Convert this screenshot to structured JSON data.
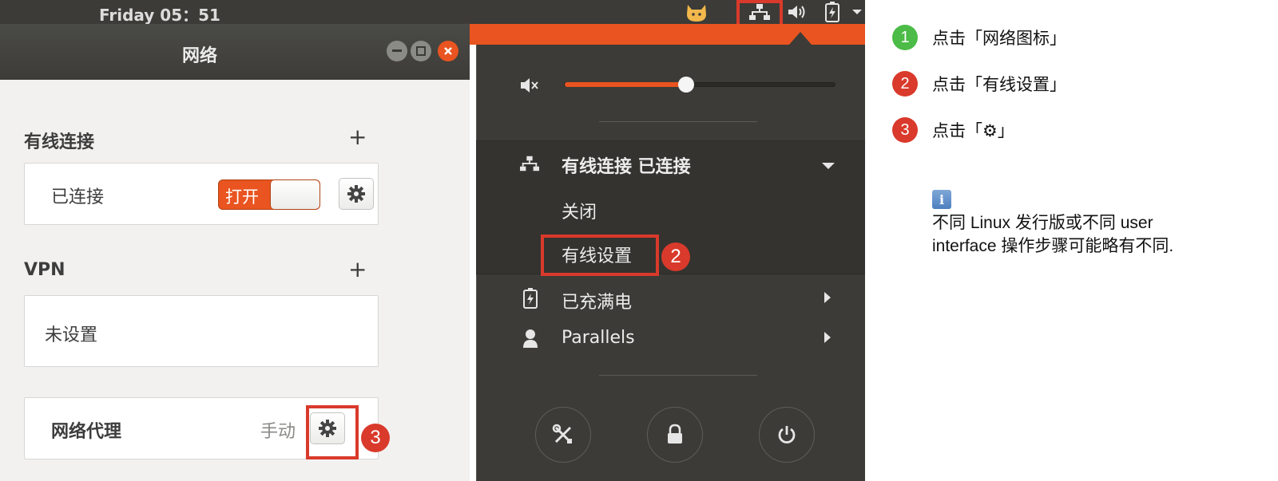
{
  "topbar": {
    "clock": "Friday 05：51",
    "icons": [
      "cat-icon",
      "network-icon",
      "volume-icon",
      "battery-icon",
      "chevron-down-icon"
    ]
  },
  "window": {
    "title": "网络",
    "wired": {
      "section_title": "有线连接",
      "status": "已连接",
      "toggle_label": "打开",
      "toggle_state": "on"
    },
    "vpn": {
      "section_title": "VPN",
      "status": "未设置"
    },
    "proxy": {
      "label": "网络代理",
      "mode": "手动"
    }
  },
  "popup": {
    "volume_level": 0.45,
    "wired_header": "有线连接 已连接",
    "turn_off": "关闭",
    "wired_settings": "有线设置",
    "battery": "已充满电",
    "user": "Parallels",
    "bottom_icons": [
      "tools-icon",
      "lock-icon",
      "power-icon"
    ]
  },
  "badges": {
    "one": "1",
    "two": "2",
    "three": "3"
  },
  "colors": {
    "accent": "#e95420",
    "step_green": "#4cbb47",
    "step_red": "#d93a2b",
    "panel_dark": "#3c3b37"
  },
  "instructions": {
    "steps": [
      {
        "num": "1",
        "text": "点击「网络图标」"
      },
      {
        "num": "2",
        "text": "点击「有线设置」"
      },
      {
        "num": "3",
        "text": "点击「⚙」"
      }
    ],
    "info_icon_text": "i",
    "note_line1": "不同 Linux 发行版或不同 user",
    "note_line2": "interface 操作步骤可能略有不同."
  }
}
